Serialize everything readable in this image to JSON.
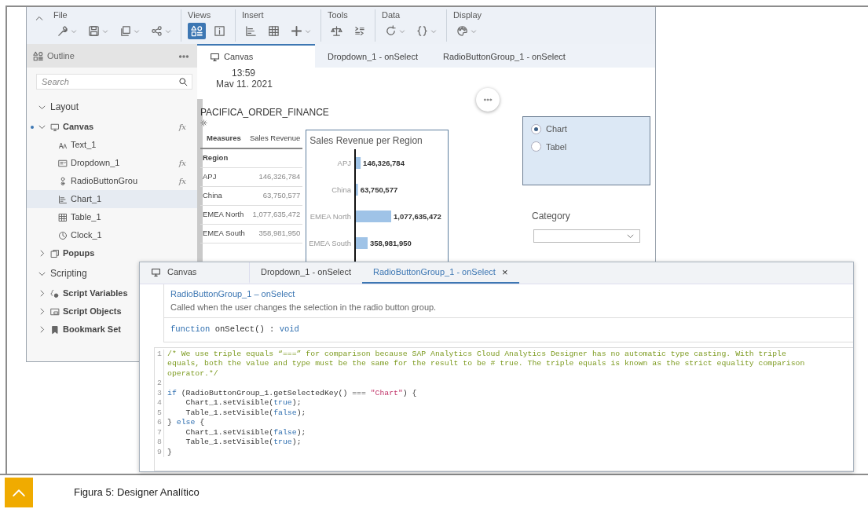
{
  "toolbar": {
    "groups": [
      {
        "label": "File",
        "tools": [
          {
            "caret": true,
            "selected": false
          },
          {
            "caret": true,
            "selected": false
          },
          {
            "caret": true,
            "selected": false
          },
          {
            "caret": true,
            "selected": false
          }
        ]
      },
      {
        "label": "Views",
        "tools": [
          {
            "caret": false,
            "selected": true
          },
          {
            "caret": false,
            "selected": false
          }
        ]
      },
      {
        "label": "Insert",
        "tools": [
          {
            "caret": false,
            "selected": false
          },
          {
            "caret": false,
            "selected": false
          },
          {
            "caret": true,
            "selected": false
          }
        ]
      },
      {
        "label": "Tools",
        "tools": [
          {
            "caret": false,
            "selected": false
          },
          {
            "caret": false,
            "selected": false
          }
        ]
      },
      {
        "label": "Data",
        "tools": [
          {
            "caret": true,
            "selected": false
          },
          {
            "caret": true,
            "selected": false
          }
        ]
      },
      {
        "label": "Display",
        "tools": [
          {
            "caret": true,
            "selected": false
          }
        ]
      }
    ]
  },
  "outline": {
    "title": "Outline",
    "search": {
      "placeholder": "Search"
    },
    "tree": [
      {
        "label": "Layout",
        "kind": "section",
        "expanded": true,
        "selected": false,
        "marked": false,
        "children": [
          {
            "label": "Canvas",
            "kind": "canvas",
            "expanded": true,
            "selected": false,
            "marked": true,
            "badge": "fx",
            "children": [
              {
                "label": "Text_1",
                "kind": "text",
                "selected": false,
                "marked": false
              },
              {
                "label": "Dropdown_1",
                "kind": "dropdown",
                "selected": false,
                "marked": false,
                "badge": "fx"
              },
              {
                "label": "RadioButtonGrou",
                "kind": "radio",
                "selected": false,
                "marked": false,
                "badge": "fx"
              },
              {
                "label": "Chart_1",
                "kind": "chart",
                "selected": true,
                "marked": false
              },
              {
                "label": "Table_1",
                "kind": "table",
                "selected": false,
                "marked": false
              },
              {
                "label": "Clock_1",
                "kind": "clock",
                "selected": false,
                "marked": false
              }
            ]
          },
          {
            "label": "Popups",
            "kind": "popup",
            "expanded": false,
            "selected": false,
            "marked": false
          }
        ]
      },
      {
        "label": "Scripting",
        "kind": "section",
        "expanded": true,
        "selected": false,
        "marked": false,
        "children": [
          {
            "label": "Script Variables",
            "kind": "variables",
            "expanded": false,
            "selected": false,
            "marked": false
          },
          {
            "label": "Script Objects",
            "kind": "objects",
            "expanded": false,
            "selected": false,
            "marked": false
          },
          {
            "label": "Bookmark Set",
            "kind": "bookmark",
            "expanded": false,
            "selected": false,
            "marked": false
          }
        ]
      }
    ]
  },
  "tabs": [
    {
      "label": "Canvas",
      "selected": true
    },
    {
      "label": "Dropdown_1 - onSelect",
      "selected": false
    },
    {
      "label": "RadioButtonGroup_1 - onSelect",
      "selected": false
    }
  ],
  "canvas": {
    "clock": {
      "time": "13:59",
      "date": "Mav 11. 2021"
    },
    "model": "PACIFICA_ORDER_FINANCE",
    "table": {
      "columns": [
        "Measures",
        "Sales Revenue"
      ],
      "row_header": "Region",
      "rows": [
        {
          "region": "APJ",
          "value": "146,326,784"
        },
        {
          "region": "China",
          "value": "63,750,577"
        },
        {
          "region": "EMEA North",
          "value": "1,077,635,472"
        },
        {
          "region": "EMEA South",
          "value": "358,981,950"
        }
      ]
    },
    "chart": {
      "chart_data": {
        "type": "bar",
        "orientation": "horizontal",
        "title": "Sales Revenue per Region",
        "categories": [
          "APJ",
          "China",
          "EMEA North",
          "EMEA South"
        ],
        "series": [
          {
            "color": "#9fc3e7",
            "values": [
              146326784,
              63750577,
              1077635472,
              358981950
            ],
            "value_labels": [
              "146,326,784",
              "63,750,577",
              "1,077,635,472",
              "358,981,950"
            ]
          }
        ]
      }
    },
    "radio_group": [
      {
        "label": "Chart",
        "selected": true
      },
      {
        "label": "Tabel",
        "selected": false
      }
    ],
    "category": {
      "label": "Category"
    }
  },
  "editor": {
    "tabs": [
      {
        "label": "Canvas",
        "selected": false
      },
      {
        "label": "Dropdown_1 - onSelect",
        "selected": false
      },
      {
        "label": "RadioButtonGroup_1 - onSelect",
        "selected": true,
        "close": "×"
      }
    ],
    "event": "RadioButtonGroup_1 – onSelect",
    "description": "Called when the user changes the selection in the radio button group.",
    "signature": [
      {
        "kind": "keyword",
        "text": "function"
      },
      {
        "kind": "plain",
        "text": " onSelect() : "
      },
      {
        "kind": "keyword",
        "text": "void"
      }
    ],
    "lines": [
      {
        "number": "1",
        "tokens": [
          {
            "kind": "comment",
            "text": "/* We use triple equals “===” for comparison because SAP Analytics Cloud Analytics Designer has no automatic type casting. With triple equals, both the value and type must be the same for the result to be # true. The triple equals is known as the strict equality comparison operator.*/"
          }
        ]
      },
      {
        "number": "2"
      },
      {
        "number": "3",
        "tokens": [
          {
            "kind": "keyword",
            "text": "if"
          },
          {
            "kind": "plain",
            "text": " (RadioButtonGroup_1.getSelectedKey() === "
          },
          {
            "kind": "string",
            "text": "\"Chart\""
          },
          {
            "kind": "plain",
            "text": ") {"
          }
        ]
      },
      {
        "number": "4",
        "tokens": [
          {
            "kind": "plain",
            "text": "    Chart_1.setVisible("
          },
          {
            "kind": "keyword",
            "text": "true"
          },
          {
            "kind": "plain",
            "text": ");"
          }
        ]
      },
      {
        "number": "5",
        "tokens": [
          {
            "kind": "plain",
            "text": "    Table_1.setVisible("
          },
          {
            "kind": "keyword",
            "text": "false"
          },
          {
            "kind": "plain",
            "text": ");"
          }
        ]
      },
      {
        "number": "6",
        "tokens": [
          {
            "kind": "plain",
            "text": "} "
          },
          {
            "kind": "keyword",
            "text": "else"
          },
          {
            "kind": "plain",
            "text": " {"
          }
        ]
      },
      {
        "number": "7",
        "tokens": [
          {
            "kind": "plain",
            "text": "    Chart_1.setVisible("
          },
          {
            "kind": "keyword",
            "text": "false"
          },
          {
            "kind": "plain",
            "text": ");"
          }
        ]
      },
      {
        "number": "8",
        "tokens": [
          {
            "kind": "plain",
            "text": "    Table_1.setVisible("
          },
          {
            "kind": "keyword",
            "text": "true"
          },
          {
            "kind": "plain",
            "text": ");"
          }
        ]
      },
      {
        "number": "9",
        "tokens": [
          {
            "kind": "plain",
            "text": "}"
          }
        ]
      }
    ]
  },
  "caption": "Figura 5: Designer Analítico"
}
